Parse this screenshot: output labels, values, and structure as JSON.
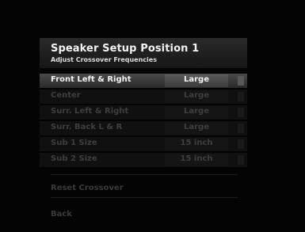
{
  "header": {
    "title": "Speaker Setup Position 1",
    "subtitle": "Adjust Crossover Frequencies"
  },
  "settings": [
    {
      "label": "Front Left & Right",
      "value": "Large",
      "selected": true
    },
    {
      "label": "Center",
      "value": "Large",
      "selected": false
    },
    {
      "label": "Surr. Left & Right",
      "value": "Large",
      "selected": false
    },
    {
      "label": "Surr. Back L & R",
      "value": "Large",
      "selected": false
    },
    {
      "label": "Sub 1 Size",
      "value": "15 inch",
      "selected": false
    },
    {
      "label": "Sub 2 Size",
      "value": "15 inch",
      "selected": false
    }
  ],
  "actions": {
    "reset_label": "Reset Crossover",
    "back_label": "Back"
  },
  "colors": {
    "background": "#050505",
    "highlight": "#4a4a4a",
    "text_active": "#f0f0f0",
    "text_dim": "#3e3e3e"
  }
}
